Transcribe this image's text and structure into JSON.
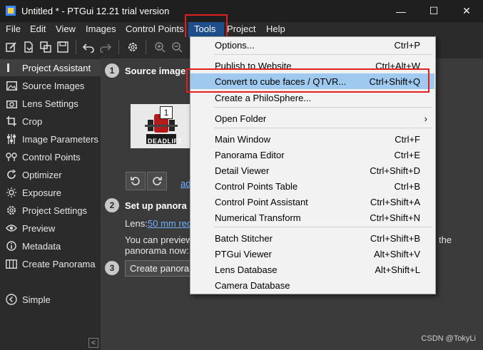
{
  "window": {
    "title": "Untitled * - PTGui 12.21 trial version",
    "minimize_glyph": "—",
    "maximize_glyph": "☐",
    "close_glyph": "✕"
  },
  "menubar": {
    "items": [
      "File",
      "Edit",
      "View",
      "Images",
      "Control Points",
      "Tools",
      "Project",
      "Help"
    ],
    "active": "Tools"
  },
  "toolbar": {
    "icons": [
      "edit-icon",
      "import-icon",
      "copy-icon",
      "save-icon",
      "undo-icon",
      "redo-icon",
      "settings-icon",
      "zoom-in-icon",
      "zoom-out-icon"
    ]
  },
  "sidebar": {
    "items": [
      {
        "label": "Project Assistant",
        "icon": "bars-icon"
      },
      {
        "label": "Source Images",
        "icon": "image-icon"
      },
      {
        "label": "Lens Settings",
        "icon": "camera-icon"
      },
      {
        "label": "Crop",
        "icon": "crop-icon"
      },
      {
        "label": "Image Parameters",
        "icon": "sliders-icon"
      },
      {
        "label": "Control Points",
        "icon": "control-points-icon"
      },
      {
        "label": "Optimizer",
        "icon": "optimizer-icon"
      },
      {
        "label": "Exposure",
        "icon": "sun-icon"
      },
      {
        "label": "Project Settings",
        "icon": "gear-icon"
      },
      {
        "label": "Preview",
        "icon": "eye-icon"
      },
      {
        "label": "Metadata",
        "icon": "info-icon"
      },
      {
        "label": "Create Panorama",
        "icon": "panorama-icon"
      }
    ],
    "simple_label": "Simple",
    "collapse_glyph": "<"
  },
  "main": {
    "step1": {
      "num": "1",
      "title": "Source image"
    },
    "thumb_badge": "1",
    "thumb_text": "DEADLIFT",
    "partial_link": "ad",
    "step2": {
      "num": "2",
      "title": "Set up panora"
    },
    "lens_label": "Lens:",
    "lens_link": "50 mm rec",
    "preview_text_1": "You can preview",
    "preview_text_2": "panorama now:",
    "preview_text_the": "the",
    "step3": {
      "num": "3"
    },
    "create_button": "Create panoran"
  },
  "tools_menu": {
    "items": [
      {
        "label": "Options...",
        "shortcut": "Ctrl+P"
      },
      {
        "label": "Publish to Website",
        "shortcut": "Ctrl+Alt+W"
      },
      {
        "label": "Convert to cube faces / QTVR...",
        "shortcut": "Ctrl+Shift+Q",
        "highlighted": true
      },
      {
        "label": "Create a PhiloSphere...",
        "shortcut": ""
      },
      {
        "label": "Open Folder",
        "shortcut": "›"
      },
      {
        "label": "Main Window",
        "shortcut": "Ctrl+F"
      },
      {
        "label": "Panorama Editor",
        "shortcut": "Ctrl+E"
      },
      {
        "label": "Detail Viewer",
        "shortcut": "Ctrl+Shift+D"
      },
      {
        "label": "Control Points Table",
        "shortcut": "Ctrl+B"
      },
      {
        "label": "Control Point Assistant",
        "shortcut": "Ctrl+Shift+A"
      },
      {
        "label": "Numerical Transform",
        "shortcut": "Ctrl+Shift+N"
      },
      {
        "label": "Batch Stitcher",
        "shortcut": "Ctrl+Shift+B"
      },
      {
        "label": "PTGui Viewer",
        "shortcut": "Alt+Shift+V"
      },
      {
        "label": "Lens Database",
        "shortcut": "Alt+Shift+L"
      },
      {
        "label": "Camera Database",
        "shortcut": ""
      }
    ]
  },
  "watermark": "CSDN @TokyLi",
  "colors": {
    "accent": "#1e4f8c",
    "highlight": "#9fc9ee",
    "annotation_red": "#e02020",
    "link": "#6fb1ff"
  }
}
